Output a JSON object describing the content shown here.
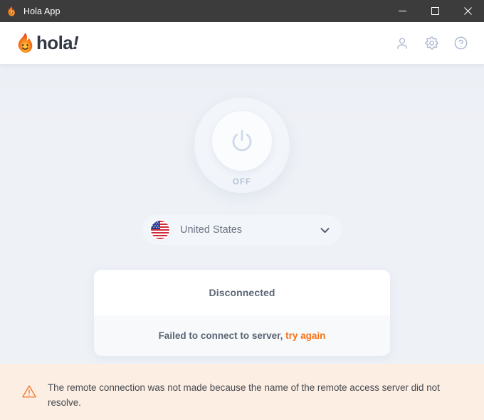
{
  "window": {
    "title": "Hola App",
    "icon": "flame-icon",
    "controls": {
      "minimize": "minimize-button",
      "maximize": "maximize-button",
      "close": "close-button"
    }
  },
  "header": {
    "logo_text": "hola",
    "logo_bang": "!",
    "icons": [
      {
        "name": "account-icon",
        "label": "Account"
      },
      {
        "name": "settings-icon",
        "label": "Settings"
      },
      {
        "name": "help-icon",
        "label": "Help"
      }
    ]
  },
  "main": {
    "power": {
      "state_label": "OFF",
      "state": "off"
    },
    "country": {
      "name": "United States",
      "flag": "us-flag-icon",
      "chevron": "chevron-down-icon"
    },
    "status": {
      "connection_state": "Disconnected",
      "error_prefix": "Failed to connect to server,",
      "retry_label": "try again"
    }
  },
  "banner": {
    "icon": "warning-triangle-icon",
    "message": "The remote connection was not made because the name of the remote access server did not resolve."
  },
  "colors": {
    "titlebar_bg": "#3c3c3c",
    "header_bg": "#ffffff",
    "body_bg": "#eef1f6",
    "accent_orange": "#f87316",
    "banner_bg": "#fdeee3",
    "banner_icon": "#f0762a",
    "text_muted": "#6e7684",
    "status_text": "#5c6575",
    "power_glyph": "#cfdaea"
  }
}
